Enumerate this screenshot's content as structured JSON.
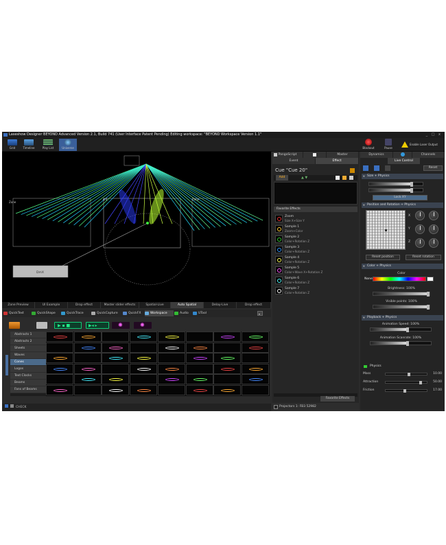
{
  "window": {
    "title": "Laseshow Designer BEYOND Advanced    Version 2.1, Build 741   (User Interface Patent Pending)    Editing workspace: \"BEYOND Workspace Version 1.1\"",
    "controls": "_ □ x"
  },
  "toolbar": {
    "buttons": [
      {
        "label": "Grid",
        "icon": "grid-icon"
      },
      {
        "label": "Timeline",
        "icon": "timeline-icon"
      },
      {
        "label": "Play List",
        "icon": "playlist-icon"
      },
      {
        "label": "Universe",
        "icon": "universe-icon"
      }
    ],
    "blackout": "Blackout",
    "pause": "Pause",
    "enable_laser": "Enable Laser Output"
  },
  "viewport": {
    "zone_labels": [
      "Zone",
      "4/4",
      "Zone"
    ],
    "dmx_label": "DmX"
  },
  "view_tabs": [
    "Zone Preview",
    "UI Example",
    "Drop effect",
    "Master slider effects",
    "Spatial-Live",
    "Auto Spatial",
    "Delay-Live",
    "Drop effect"
  ],
  "quick_tabs": [
    "QuickText",
    "QuickShape",
    "QuickTrace",
    "QuickCapture",
    "QuickFX",
    "Workspace",
    "Audio",
    "UTool"
  ],
  "undock": "Undock",
  "categories": [
    "Abstracts 1",
    "Abstracts 2",
    "Sheets",
    "Waves",
    "Cones",
    "Logos",
    "Text Clocks",
    "Beams",
    "Fans of Beams"
  ],
  "selected_category": "Cones",
  "status_left": "CHECK",
  "mid": {
    "tabs_top": [
      "PangoScript",
      "",
      "Master"
    ],
    "tabs_second": [
      "Event",
      "Effect"
    ],
    "cue_title": "Cue \"Cue 20\"",
    "add_label": "Add",
    "favorites_header": "Favorite Effects",
    "favorites": [
      {
        "name": "Zoom",
        "desc": "Size X+Size Y"
      },
      {
        "name": "Sample 1",
        "desc": "Zoom+Color"
      },
      {
        "name": "Sample 2",
        "desc": "Color+Rotation Z"
      },
      {
        "name": "Sample 3",
        "desc": "Color+Rotation Z"
      },
      {
        "name": "Sample 4",
        "desc": "Color+Rotation Z"
      },
      {
        "name": "Sample 5",
        "desc": "Color+Wave X+Rotation Z"
      },
      {
        "name": "Sample 6",
        "desc": "Color+Rotation Z"
      },
      {
        "name": "Sample 7",
        "desc": "Color+Rotation Z"
      }
    ],
    "fav_tab": "Favorite Effects",
    "status": "Projectors 1: FB3 52982"
  },
  "right": {
    "tabs_top": [
      "Dynamics",
      "",
      "Channels"
    ],
    "tab_live": "Live Control",
    "reset": "Reset",
    "size_header": "Size + Physics",
    "lock_xy": "Lock XY",
    "position_header": "Position and Rotation + Physics",
    "axis": [
      "X",
      "Y",
      "Z"
    ],
    "reset_position": "Reset position",
    "reset_rotation": "Reset rotation",
    "color_header": "Color + Physics",
    "color_label": "Color",
    "color_mode": "None",
    "brightness": "Brightness: 100%",
    "visible_points": "Visible points: 100%",
    "playback_header": "Playback + Physics",
    "anim_speed": "Animation Speed: 100%",
    "anim_scanrate": "Animation Scanrate: 100%",
    "physics_header": "Physics",
    "physics": [
      {
        "label": "Mass",
        "value": "10.00",
        "pos": 0.55
      },
      {
        "label": "Attraction",
        "value": "50.00",
        "pos": 0.85
      },
      {
        "label": "Friction",
        "value": "17.00",
        "pos": 0.45
      }
    ]
  }
}
